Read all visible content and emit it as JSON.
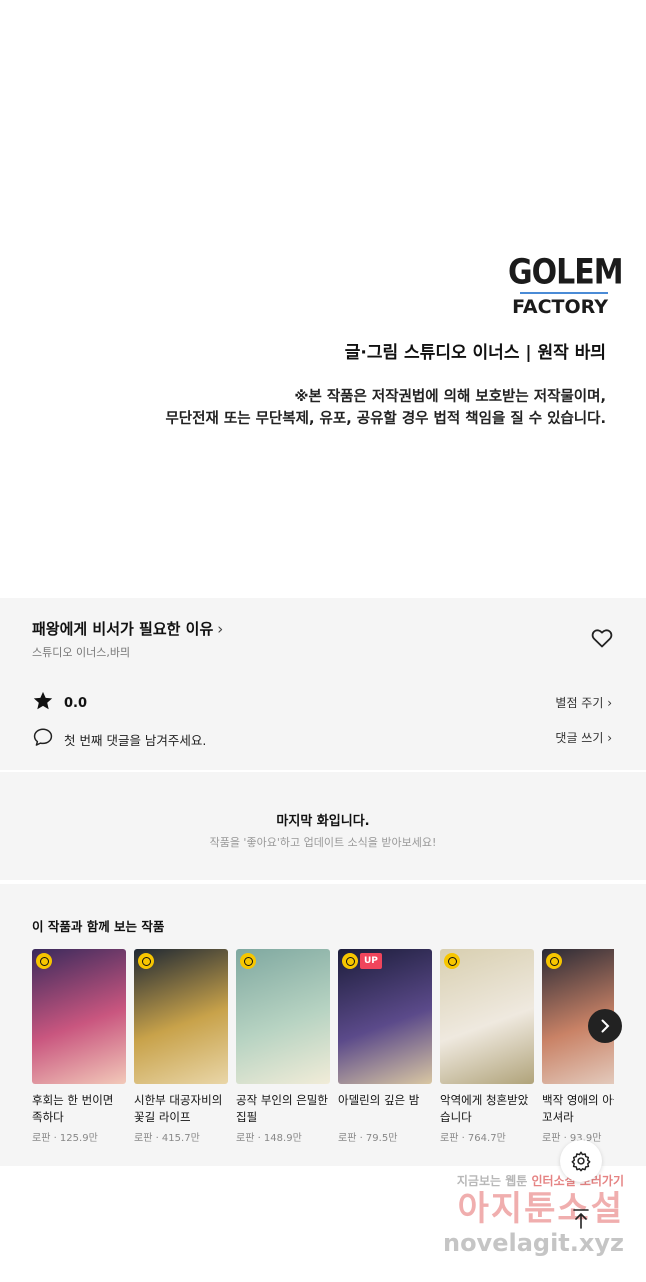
{
  "credits": {
    "logo_line1": "GOLEM",
    "logo_line2": "FACTORY",
    "credit_line": "글·그림 스튜디오 이너스  |  원작 바믜",
    "notice_line1": "※본 작품은 저작권법에 의해 보호받는 저작물이며,",
    "notice_line2": "무단전재 또는 무단복제, 유포, 공유할 경우 법적 책임을 질 수 있습니다."
  },
  "info": {
    "title": "패왕에게 비서가 필요한 이유",
    "title_chevron": "›",
    "authors": "스튜디오 이너스,바믜",
    "rating": "0.0",
    "rate_link": "별점 주기 ›",
    "comment_prompt": "첫 번째 댓글을 남겨주세요.",
    "comment_link": "댓글 쓰기 ›"
  },
  "last_episode": {
    "heading": "마지막 화입니다.",
    "sub": "작품을 '좋아요'하고 업데이트 소식을 받아보세요!"
  },
  "recommendations": {
    "heading": "이 작품과 함께 보는 작품",
    "items": [
      {
        "name": "후회는 한 번이면 족하다",
        "meta": "로판 · 125.9만",
        "up": "",
        "colors": [
          "#3a2a5c",
          "#c9567f",
          "#f2c9b9"
        ]
      },
      {
        "name": "시한부 대공자비의 꽃길 라이프",
        "meta": "로판 · 415.7만",
        "up": "",
        "colors": [
          "#1f2833",
          "#c8a24a",
          "#e9d6a8"
        ]
      },
      {
        "name": "공작 부인의 은밀한 집필",
        "meta": "로판 · 148.9만",
        "up": "",
        "colors": [
          "#7fa8a0",
          "#b7d3c2",
          "#f1ecd8"
        ]
      },
      {
        "name": "아델린의 깊은 밤",
        "meta": "로판 · 79.5만",
        "up": "UP",
        "colors": [
          "#1c1d3a",
          "#5b4a8a",
          "#d9c7a3"
        ]
      },
      {
        "name": "악역에게 청혼받았습니다",
        "meta": "로판 · 764.7만",
        "up": "",
        "colors": [
          "#d8cfb0",
          "#efe9df",
          "#b0a37a"
        ]
      },
      {
        "name": "백작 영애의 아을 꼬셔라",
        "meta": "로판 · 93.9만",
        "up": "",
        "colors": [
          "#2a2a35",
          "#c98266",
          "#e6d2c6"
        ]
      }
    ]
  },
  "watermark": {
    "line1a": "지금보는 웹툰 ",
    "line1b": "인터소설 보러가기",
    "line2": "아지툰소설",
    "line3": "novelagit.xyz"
  }
}
